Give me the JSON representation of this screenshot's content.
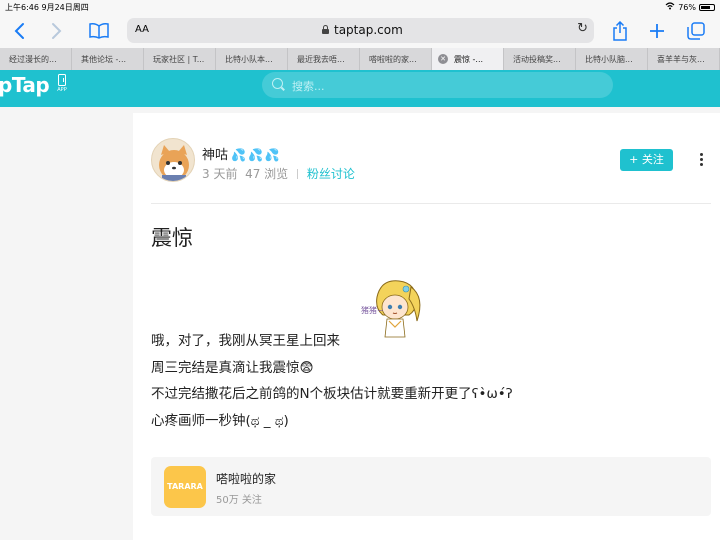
{
  "status_bar": {
    "time_date": "上午6:46   9月24日周四",
    "battery": "76%",
    "battery_level": 0.76
  },
  "browser": {
    "text_size_label": "AA",
    "url": "taptap.com",
    "tabs": [
      {
        "label": "经过漫长的..."
      },
      {
        "label": "其他论坛 -..."
      },
      {
        "label": "玩家社区 | T..."
      },
      {
        "label": "比特小队本..."
      },
      {
        "label": "最近我去唔..."
      },
      {
        "label": "嗒啦啦的家..."
      },
      {
        "label": "震惊 -...",
        "active": true
      },
      {
        "label": "活动投稿奖..."
      },
      {
        "label": "比特小队脑..."
      },
      {
        "label": "喜羊羊与灰..."
      }
    ]
  },
  "site": {
    "logo": "pTap",
    "app_label": "APP",
    "search_placeholder": "搜索..."
  },
  "post": {
    "author": "神咕",
    "author_emoji": "💦💦💦",
    "time": "3 天前",
    "views": "47 浏览",
    "category": "粉丝讨论",
    "follow_label": "+ 关注",
    "title": "震惊",
    "sticker_text": "猪猪~",
    "lines": [
      "哦，对了，我刚从冥王星上回来",
      "周三完结是真滴让我震惊😨",
      "不过完结撒花后之前鸽的N个板块估计就要重新开更了ʕ•̀ω•́ʔ",
      "心疼画师一秒钟(ಥ _ ಥ)"
    ]
  },
  "group": {
    "logo_text": "TARARA",
    "name": "嗒啦啦的家",
    "followers": "50万 关注"
  }
}
